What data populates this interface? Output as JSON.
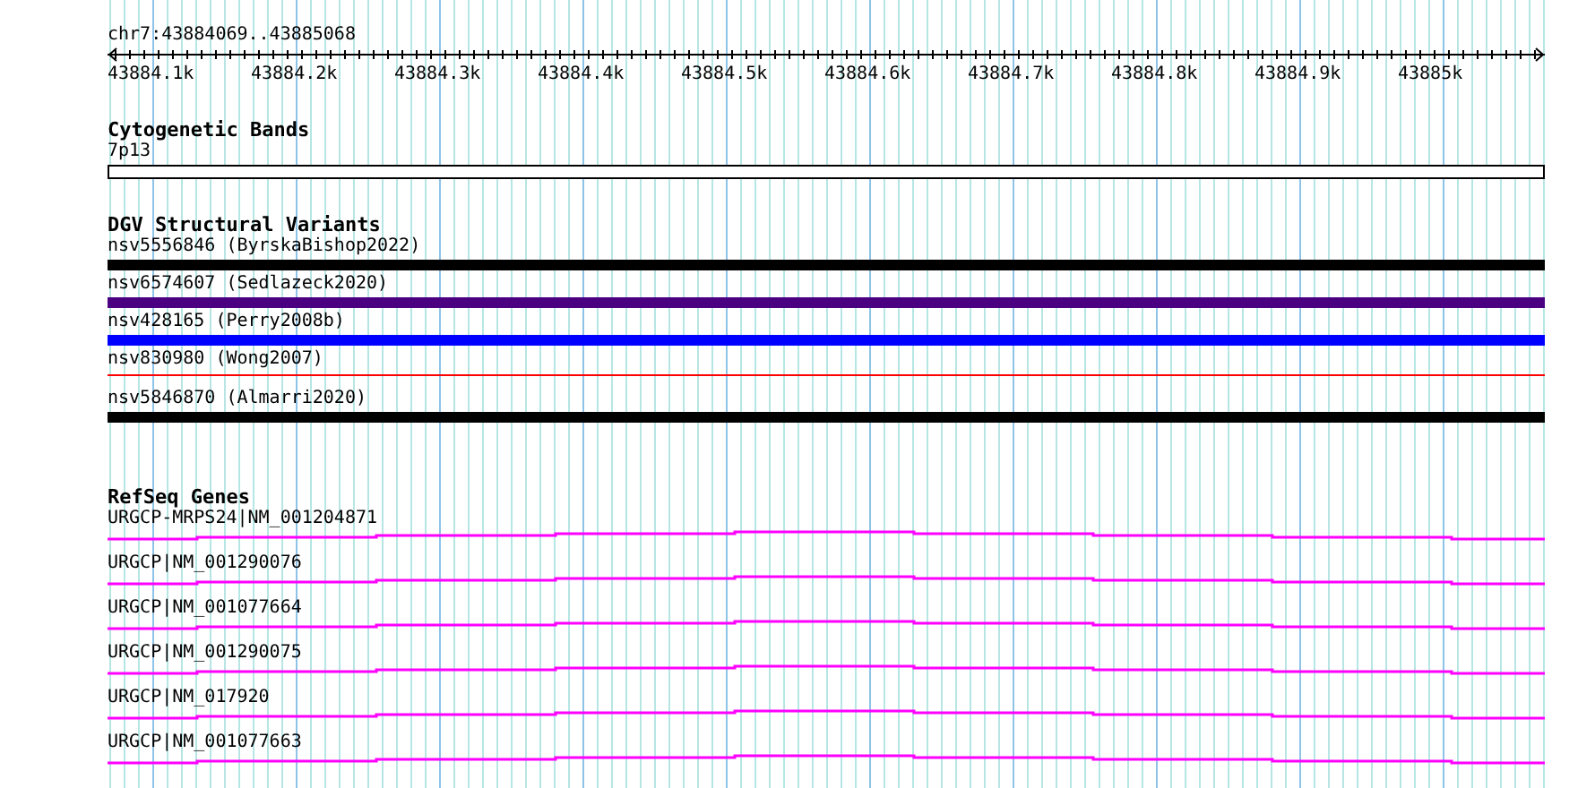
{
  "ruler": {
    "position": "chr7:43884069..43885068",
    "ticks": [
      "43884.1k",
      "43884.2k",
      "43884.3k",
      "43884.4k",
      "43884.5k",
      "43884.6k",
      "43884.7k",
      "43884.8k",
      "43884.9k",
      "43885k"
    ]
  },
  "cytogenetic_bands": {
    "title": "Cytogenetic Bands",
    "bands": [
      {
        "name": "7p13"
      }
    ]
  },
  "dgv_structural_variants": {
    "title": "DGV Structural Variants",
    "features": [
      {
        "label": "nsv5556846 (ByrskaBishop2022)",
        "kind": "thick",
        "color": "#000000"
      },
      {
        "label": "nsv6574607 (Sedlazeck2020)",
        "kind": "thick",
        "color": "#4b0082"
      },
      {
        "label": "nsv428165 (Perry2008b)",
        "kind": "thick",
        "color": "#0000ff"
      },
      {
        "label": "nsv830980 (Wong2007)",
        "kind": "thin",
        "color": "#ff0000"
      },
      {
        "label": "nsv5846870 (Almarri2020)",
        "kind": "thick",
        "color": "#000000"
      }
    ]
  },
  "refseq_genes": {
    "title": "RefSeq Genes",
    "genes": [
      {
        "label": "URGCP-MRPS24|NM_001204871"
      },
      {
        "label": "URGCP|NM_001290076"
      },
      {
        "label": "URGCP|NM_001077664"
      },
      {
        "label": "URGCP|NM_001290075"
      },
      {
        "label": "URGCP|NM_017920"
      },
      {
        "label": "URGCP|NM_001077663"
      }
    ]
  }
}
